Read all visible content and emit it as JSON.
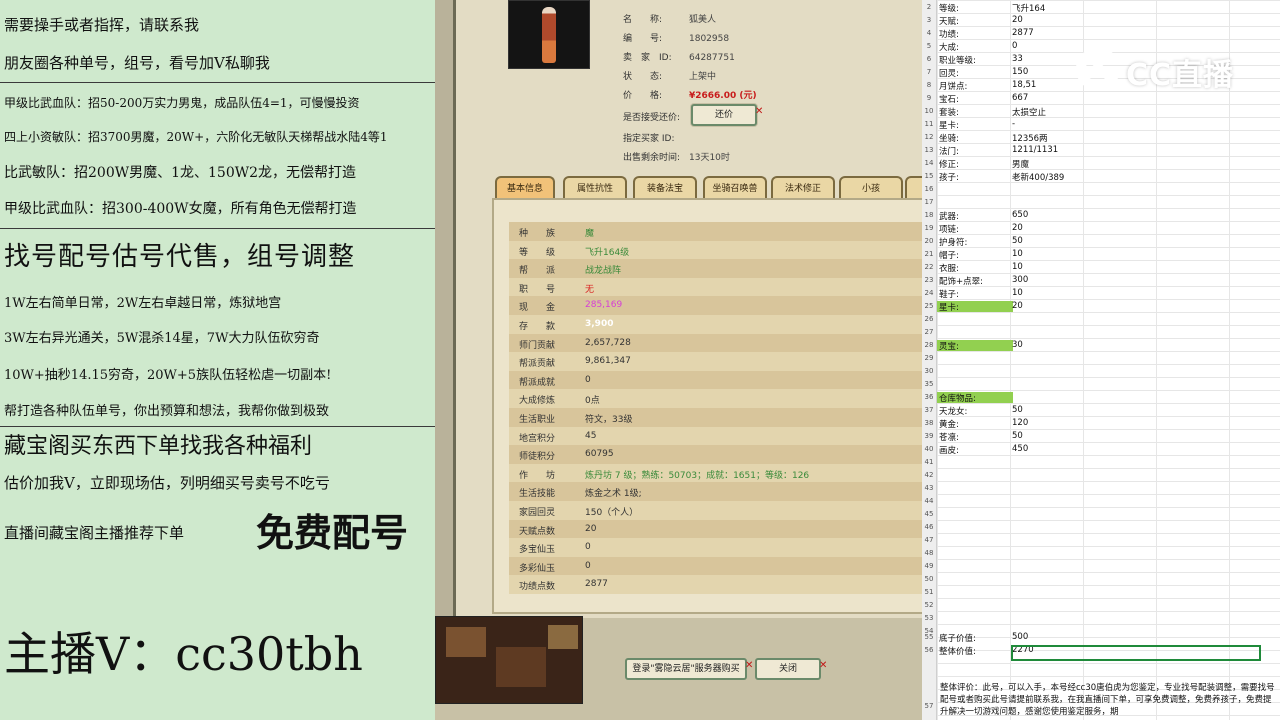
{
  "left_panel": {
    "lines": [
      "需要操手或者指挥，请联系我",
      "朋友圈各种单号，组号，看号加V私聊我",
      "甲级比武血队：招50-200万实力男鬼，成品队伍4=1，可慢慢投资",
      "四上小资敏队：招3700男魔，20W+，六阶化无敏队天梯帮战水陆4等1",
      "比武敏队：招200W男魔、1龙、150W2龙，无偿帮打造",
      "甲级比武血队：招300-400W女魔，所有角色无偿帮打造",
      "找号配号估号代售，组号调整",
      "1W左右简单日常，2W左右卓越日常，炼狱地宫",
      "3W左右异光通关，5W混杀14星，7W大力队伍砍穷奇",
      "10W+抽秒14.15穷奇，20W+5族队伍轻松虐一切副本!",
      "帮打造各种队伍单号，你出预算和想法，我帮你做到极致",
      "藏宝阁买东西下单找我各种福利",
      "估价加我V，立即现场估，列明细买号卖号不吃亏",
      "直播间藏宝阁主播推荐下单",
      "免费配号",
      "主播V：cc30tbh"
    ]
  },
  "game": {
    "info": {
      "name_label": "名　　称:",
      "name": "狐美人",
      "id_label": "编　　号:",
      "id": "1802958",
      "seller_label": "卖　家　ID:",
      "seller": "64287751",
      "status_label": "状　　态:",
      "status": "上架中",
      "price_label": "价　　格:",
      "price": "¥2666.00 (元)",
      "bargain_label": "是否接受还价:",
      "bargain_button": "还价",
      "buyer_label": "指定买家 ID:",
      "remain_label": "出售剩余时间:",
      "remain": "13天10时"
    },
    "tabs": [
      "基本信息",
      "属性抗性",
      "装备法宝",
      "坐骑召唤兽",
      "法术修正",
      "小孩"
    ],
    "active_tab": 0,
    "rows": [
      {
        "k": "种　　族",
        "v": "魔",
        "c": "#3a8a3a"
      },
      {
        "k": "等　　级",
        "v": "飞升164级",
        "c": "#3a8a3a"
      },
      {
        "k": "帮　　派",
        "v": "战龙战阵",
        "c": "#3a8a3a"
      },
      {
        "k": "职　　号",
        "v": "无",
        "c": "#d81e1e"
      },
      {
        "k": "现　　金",
        "v": "285,169",
        "c": "#d63fd6"
      },
      {
        "k": "存　　款",
        "v": "3,900",
        "c": "#ffffff"
      },
      {
        "k": "师门贡献",
        "v": "2,657,728",
        "c": "#333333"
      },
      {
        "k": "帮派贡献",
        "v": "9,861,347",
        "c": "#333333"
      },
      {
        "k": "帮派成就",
        "v": "0",
        "c": "#333333"
      },
      {
        "k": "大成修炼",
        "v": "0点",
        "c": "#333333"
      },
      {
        "k": "生活职业",
        "v": "符文，33级",
        "c": "#333333"
      },
      {
        "k": "地宫积分",
        "v": "45",
        "c": "#333333"
      },
      {
        "k": "师徒积分",
        "v": "60795",
        "c": "#333333"
      },
      {
        "k": "作　　坊",
        "v": "炼丹坊 7 级；熟练：50703；成就：1651；等级：126",
        "c": "#3a8a3a"
      },
      {
        "k": "生活技能",
        "v": "炼金之术 1级;",
        "c": "#333333"
      },
      {
        "k": "家园回灵",
        "v": "150（个人）",
        "c": "#333333"
      },
      {
        "k": "天赋点数",
        "v": "20",
        "c": "#333333"
      },
      {
        "k": "多宝仙玉",
        "v": "0",
        "c": "#333333"
      },
      {
        "k": "多彩仙玉",
        "v": "0",
        "c": "#333333"
      },
      {
        "k": "功绩点数",
        "v": "2877",
        "c": "#333333"
      }
    ],
    "login_button": "登录\"雾隐云居\"服务器购买",
    "close_button": "关闭"
  },
  "sheet": {
    "rows": [
      {
        "n": "2",
        "a": "等级:",
        "b": "飞升164"
      },
      {
        "n": "3",
        "a": "天赋:",
        "b": "20"
      },
      {
        "n": "4",
        "a": "功绩:",
        "b": "2877"
      },
      {
        "n": "5",
        "a": "大成:",
        "b": "0"
      },
      {
        "n": "6",
        "a": "职业等级:",
        "b": "33"
      },
      {
        "n": "7",
        "a": "回灵:",
        "b": "150"
      },
      {
        "n": "8",
        "a": "月饼点:",
        "b": "18,51"
      },
      {
        "n": "9",
        "a": "宝石:",
        "b": "667"
      },
      {
        "n": "10",
        "a": "套装:",
        "b": "太损空止"
      },
      {
        "n": "11",
        "a": "星卡:",
        "b": "-"
      },
      {
        "n": "12",
        "a": "坐骑:",
        "b": "12356两"
      },
      {
        "n": "13",
        "a": "法门:",
        "b": "1211/1131"
      },
      {
        "n": "14",
        "a": "修正:",
        "b": "男魔"
      },
      {
        "n": "15",
        "a": "孩子:",
        "b": "老新400/389"
      },
      {
        "n": "16",
        "a": "",
        "b": ""
      },
      {
        "n": "17",
        "a": "",
        "b": ""
      },
      {
        "n": "18",
        "a": "武器:",
        "b": "650"
      },
      {
        "n": "19",
        "a": "项链:",
        "b": "20"
      },
      {
        "n": "20",
        "a": "护身符:",
        "b": "50"
      },
      {
        "n": "21",
        "a": "帽子:",
        "b": "10"
      },
      {
        "n": "22",
        "a": "衣服:",
        "b": "10"
      },
      {
        "n": "23",
        "a": "配饰+点翠:",
        "b": "300"
      },
      {
        "n": "24",
        "a": "鞋子:",
        "b": "10"
      },
      {
        "n": "25",
        "a": "星卡:",
        "b": "20",
        "hl": true
      },
      {
        "n": "26",
        "a": "",
        "b": ""
      },
      {
        "n": "27",
        "a": "",
        "b": ""
      },
      {
        "n": "28",
        "a": "灵宝:",
        "b": "30",
        "hl": true
      },
      {
        "n": "29",
        "a": "",
        "b": ""
      },
      {
        "n": "30",
        "a": "",
        "b": ""
      },
      {
        "n": "35",
        "a": "",
        "b": ""
      },
      {
        "n": "36",
        "a": "仓库物品:",
        "b": "",
        "hl": true
      },
      {
        "n": "37",
        "a": "天龙女:",
        "b": "50"
      },
      {
        "n": "38",
        "a": "黄金:",
        "b": "120"
      },
      {
        "n": "39",
        "a": "苍凛:",
        "b": "50"
      },
      {
        "n": "40",
        "a": "画皮:",
        "b": "450"
      }
    ],
    "blank_numbers": [
      "41",
      "42",
      "43",
      "44",
      "45",
      "46",
      "47",
      "48",
      "49",
      "50",
      "51",
      "52",
      "53",
      "54"
    ],
    "total_rows": [
      {
        "n": "55",
        "a": "底子价值:",
        "b": "500"
      },
      {
        "n": "56",
        "a": "整体价值:",
        "b": "2270"
      }
    ],
    "eval_row_number": "57",
    "evaluation": "整体评价：此号，可以入手，本号经cc30唐伯虎为您鉴定，专业找号配装调整，需要找号配号或者购买此号请提前联系我，在我直播间下单，可享免费调整，免费养孩子，免费提升解决一切游戏问题，感谢您使用鉴定服务，期"
  },
  "logo": {
    "text": "CC直播"
  }
}
